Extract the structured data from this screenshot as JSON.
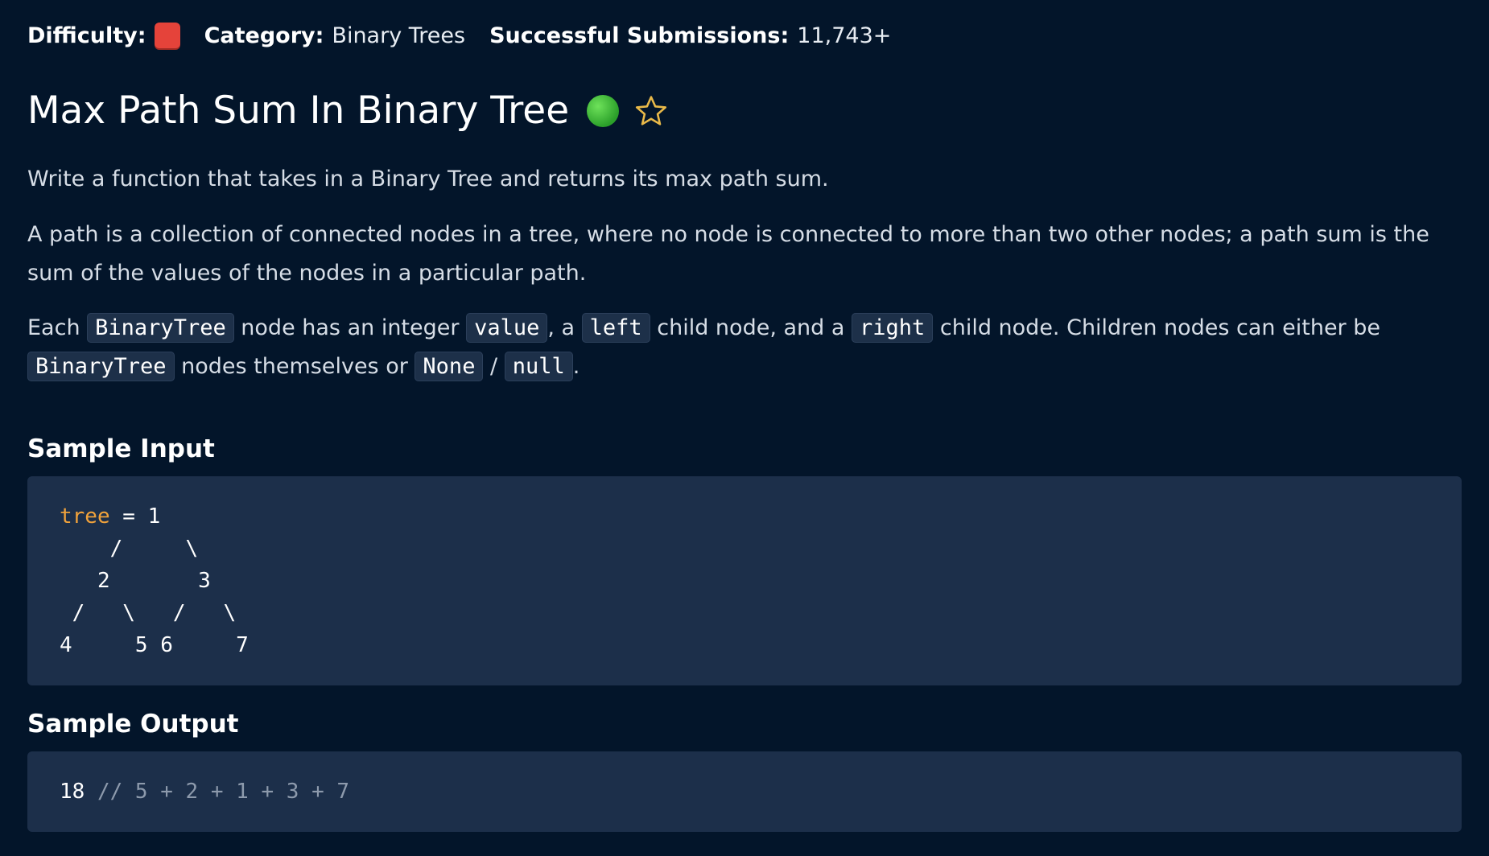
{
  "meta": {
    "difficulty_label": "Difficulty:",
    "difficulty_color": "#e5433a",
    "category_label": "Category:",
    "category_value": "Binary Trees",
    "submissions_label": "Successful Submissions:",
    "submissions_value": "11,743+"
  },
  "question": {
    "title": "Max Path Sum In Binary Tree",
    "status_color": "#3cc13b",
    "star_icon": "star-outline-icon",
    "star_color": "#e9b949"
  },
  "description": {
    "p1": "Write a function that takes in a Binary Tree and returns its max path sum.",
    "p2": "A path is a collection of connected nodes in a tree, where no node is connected to more than two other nodes; a path sum is the sum of the values of the nodes in a particular path.",
    "p3": {
      "t1": "Each ",
      "c1": "BinaryTree",
      "t2": " node has an integer ",
      "c2": "value",
      "t3": ", a ",
      "c3": "left",
      "t4": " child node, and a ",
      "c4": "right",
      "t5": " child node. Children nodes can either be ",
      "c5": "BinaryTree",
      "t6": " nodes themselves or ",
      "c6": "None",
      "t7": " / ",
      "c7": "null",
      "t8": "."
    }
  },
  "sample_input": {
    "heading": "Sample Input",
    "var_name": "tree",
    "line1_rest": " = 1",
    "line2": "    /     \\",
    "line3": "   2       3",
    "line4": " /   \\   /   \\",
    "line5": "4     5 6     7"
  },
  "sample_output": {
    "heading": "Sample Output",
    "value": "18",
    "comment": " // 5 + 2 + 1 + 3 + 7"
  }
}
